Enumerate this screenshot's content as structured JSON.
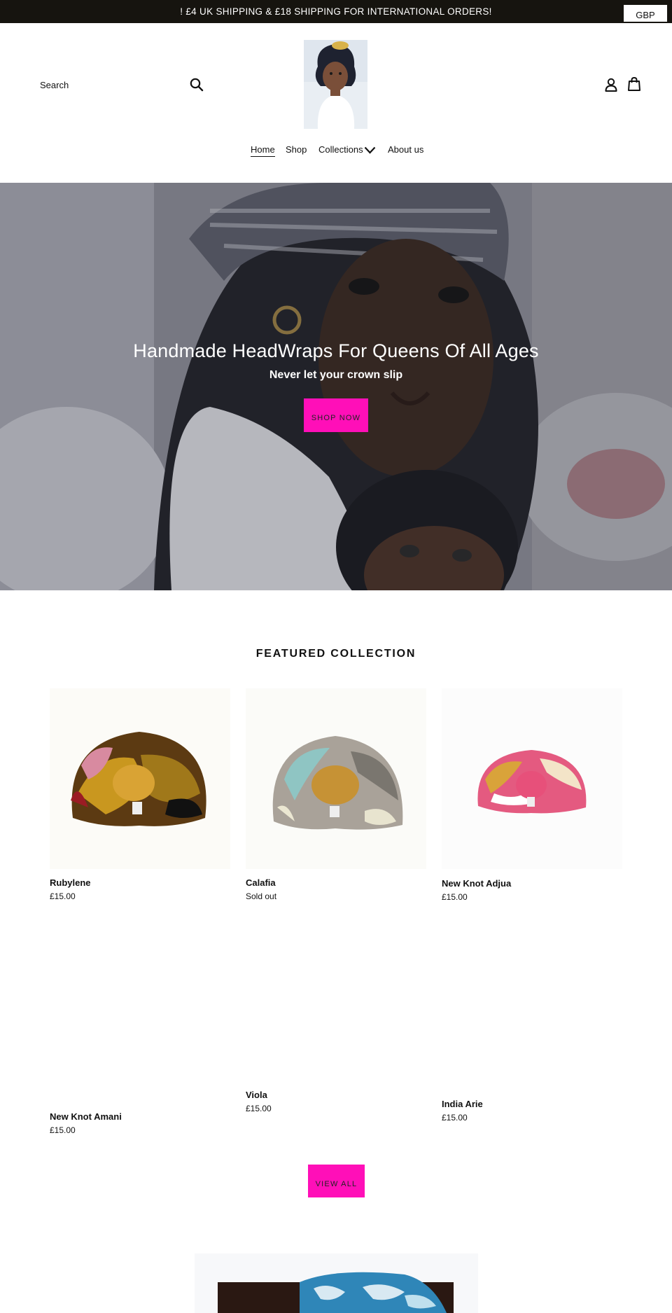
{
  "announcement": {
    "text": "! £4 UK SHIPPING & £18 SHIPPING FOR INTERNATIONAL ORDERS!",
    "currency": "GBP"
  },
  "header": {
    "search_placeholder": "Search",
    "logo_alt": "Store logo",
    "icons": [
      "search-icon",
      "account-icon",
      "cart-icon"
    ]
  },
  "nav": {
    "items": [
      {
        "label": "Home",
        "active": true
      },
      {
        "label": "Shop"
      },
      {
        "label": "Collections",
        "has_dropdown": true
      },
      {
        "label": "About us"
      }
    ]
  },
  "hero": {
    "title": "Handmade HeadWraps For Queens Of All Ages",
    "subtitle": "Never let your crown slip",
    "button_label": "SHOP NOW"
  },
  "featured": {
    "heading": "FEATURED COLLECTION",
    "products": [
      {
        "title": "Rubylene",
        "price": "£15.00"
      },
      {
        "title": "Calafia",
        "price": "Sold out"
      },
      {
        "title": "New Knot Adjua",
        "price": "£15.00"
      },
      {
        "title": "New Knot Amani",
        "price": "£15.00"
      },
      {
        "title": "Viola",
        "price": "£15.00"
      },
      {
        "title": "India Arie",
        "price": "£15.00"
      }
    ],
    "view_all_label": "VIEW ALL"
  },
  "colors": {
    "announcement_bg": "#16140f",
    "accent": "#ff0fb8",
    "text": "#111111"
  }
}
